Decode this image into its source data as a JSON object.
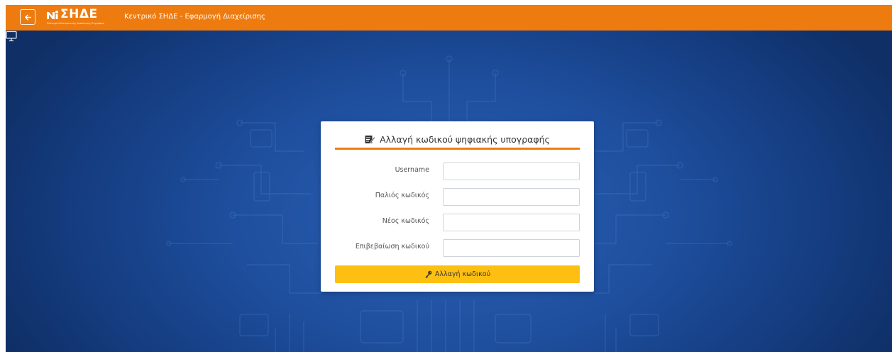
{
  "header": {
    "logo_text": "ΣΗΔΕ",
    "logo_subtitle": "Σύστημα Ηλεκτρονικής Διακίνησης Εγγράφων",
    "app_title": "Κεντρικό ΣΗΔΕ - Εφαρμογή Διαχείρισης",
    "icons": {
      "back": "arrow-left-icon",
      "logo": "logo-mark-icon"
    }
  },
  "form": {
    "title": "Αλλαγή κωδικού ψηφιακής υπογραφής",
    "title_icon": "signature-icon",
    "fields": [
      {
        "label": "Username",
        "value": "",
        "type": "text"
      },
      {
        "label": "Παλιός κωδικός",
        "value": "",
        "type": "password"
      },
      {
        "label": "Νέος κωδικός",
        "value": "",
        "type": "password"
      },
      {
        "label": "Επιβεβαίωση κωδικού",
        "value": "",
        "type": "password"
      }
    ],
    "submit_label": "Αλλαγή κωδικού",
    "submit_icon": "key-icon"
  },
  "decor": {
    "corner_icon": "monitor-icon"
  },
  "colors": {
    "header": "#ee7b0f",
    "background": "#1e4e9d",
    "accent_rule": "#ee7b0f",
    "button": "#fdc012",
    "card": "#ffffff"
  }
}
